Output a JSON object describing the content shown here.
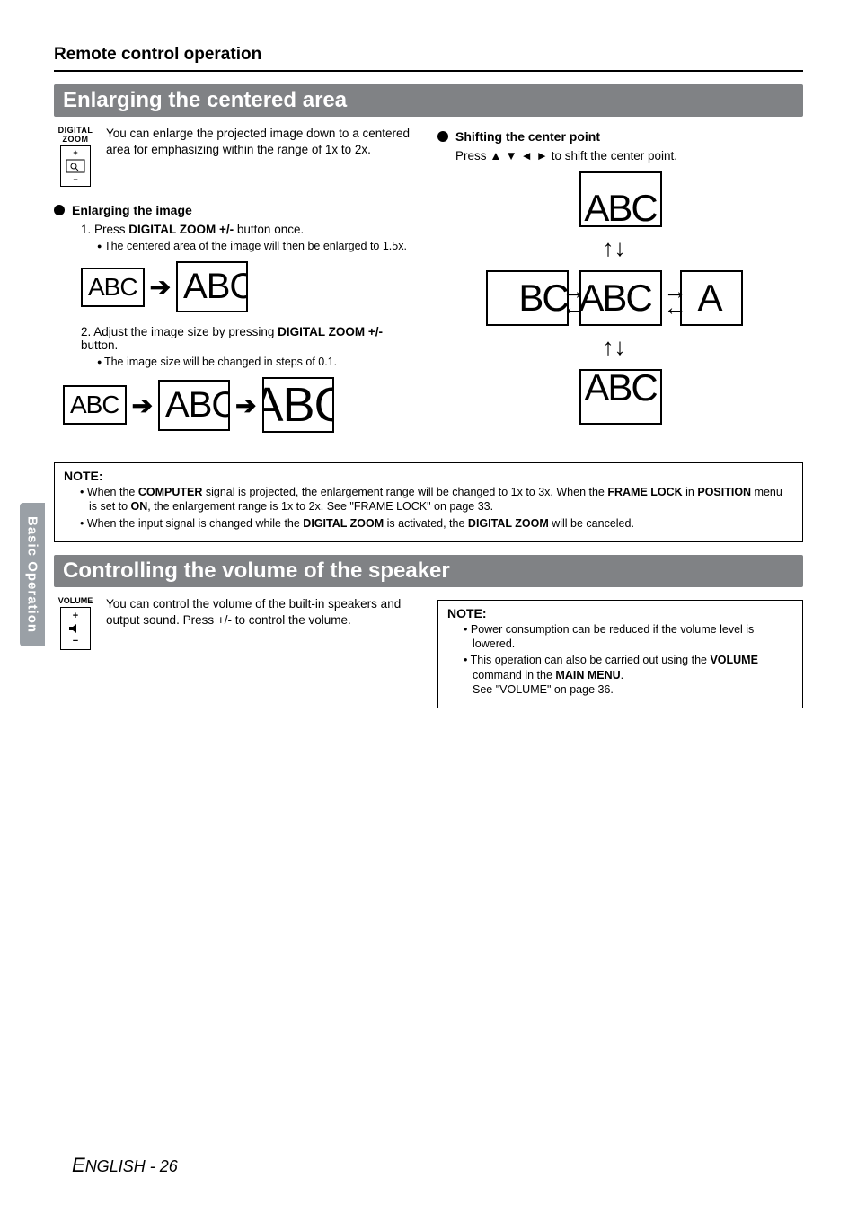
{
  "side_tab": "Basic Operation",
  "chapter_title": "Remote control operation",
  "section1": {
    "title": "Enlarging the centered area",
    "remote_label": "DIGITAL ZOOM",
    "intro": "You can enlarge the projected image down to a centered area for emphasizing within the range of 1x to 2x.",
    "sub1_title": "Enlarging the image",
    "step1_prefix": "1.  Press ",
    "step1_bold": "DIGITAL ZOOM +/-",
    "step1_suffix": " button once.",
    "step1_sub": "The centered area of the image will then be enlarged to 1.5x.",
    "step2_prefix": "2.  Adjust the image size by pressing ",
    "step2_bold": "DIGITAL ZOOM +/-",
    "step2_suffix": " button.",
    "step2_sub": "The image size will be changed in steps of 0.1.",
    "sub2_title": "Shifting the center point",
    "sub2_text_prefix": "Press ",
    "sub2_text_suffix": " to shift the center point.",
    "tile_text_full": "ABC",
    "tile_text_crop1": "ABC",
    "tile_text_crop2": "BC",
    "note_title": "NOTE:",
    "note_items": [
      {
        "parts": [
          "When the ",
          "COMPUTER",
          " signal is projected, the enlargement range will be changed to 1x to 3x. When the ",
          "FRAME LOCK",
          " in ",
          "POSITION",
          " menu is set to ",
          "ON",
          ", the enlargement range is 1x to 2x. See \"FRAME LOCK\" on page 33."
        ]
      },
      {
        "parts": [
          "When the input signal is changed while the ",
          "DIGITAL ZOOM",
          " is activated, the ",
          "DIGITAL ZOOM",
          " will be canceled."
        ]
      }
    ]
  },
  "section2": {
    "title": "Controlling the volume of the speaker",
    "remote_label": "VOLUME",
    "intro": "You can control the volume of the built-in speakers and output sound. Press +/- to control the volume.",
    "note_title": "NOTE:",
    "note_items": [
      "Power consumption can be reduced if the volume level is lowered.",
      {
        "parts": [
          "This operation can also be carried out using the ",
          "VOLUME",
          " command in the ",
          "MAIN MENU",
          ".",
          "\nSee \"VOLUME\" on page 36."
        ]
      }
    ]
  },
  "footer": {
    "lang": "ENGLISH",
    "sep": " - ",
    "page": "26"
  }
}
